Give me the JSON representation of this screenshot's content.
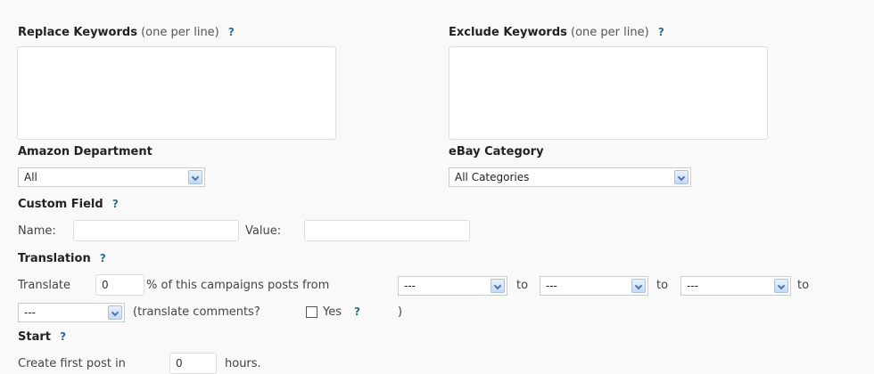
{
  "replace_keywords": {
    "label": "Replace Keywords",
    "hint": "(one per line)",
    "help": "?"
  },
  "exclude_keywords": {
    "label": "Exclude Keywords",
    "hint": "(one per line)",
    "help": "?"
  },
  "amazon_department": {
    "label": "Amazon Department",
    "value": "All"
  },
  "ebay_category": {
    "label": "eBay Category",
    "value": "All Categories"
  },
  "custom_field": {
    "label": "Custom Field",
    "help": "?",
    "name_label": "Name:",
    "name_value": "",
    "value_label": "Value:",
    "value_value": ""
  },
  "translation": {
    "label": "Translation",
    "help": "?",
    "prefix": "Translate",
    "percent_value": "0",
    "from_text": "% of this campaigns posts from",
    "lang1": "---",
    "to1": "to",
    "lang2": "---",
    "to2": "to",
    "lang3": "---",
    "to3": "to",
    "lang4": "---",
    "comments_text": "(translate comments?",
    "yes_label": "Yes",
    "help2": "?",
    "close": ")"
  },
  "start": {
    "label": "Start",
    "help": "?",
    "prefix": "Create first post in",
    "hours_value": "0",
    "suffix": "hours."
  }
}
